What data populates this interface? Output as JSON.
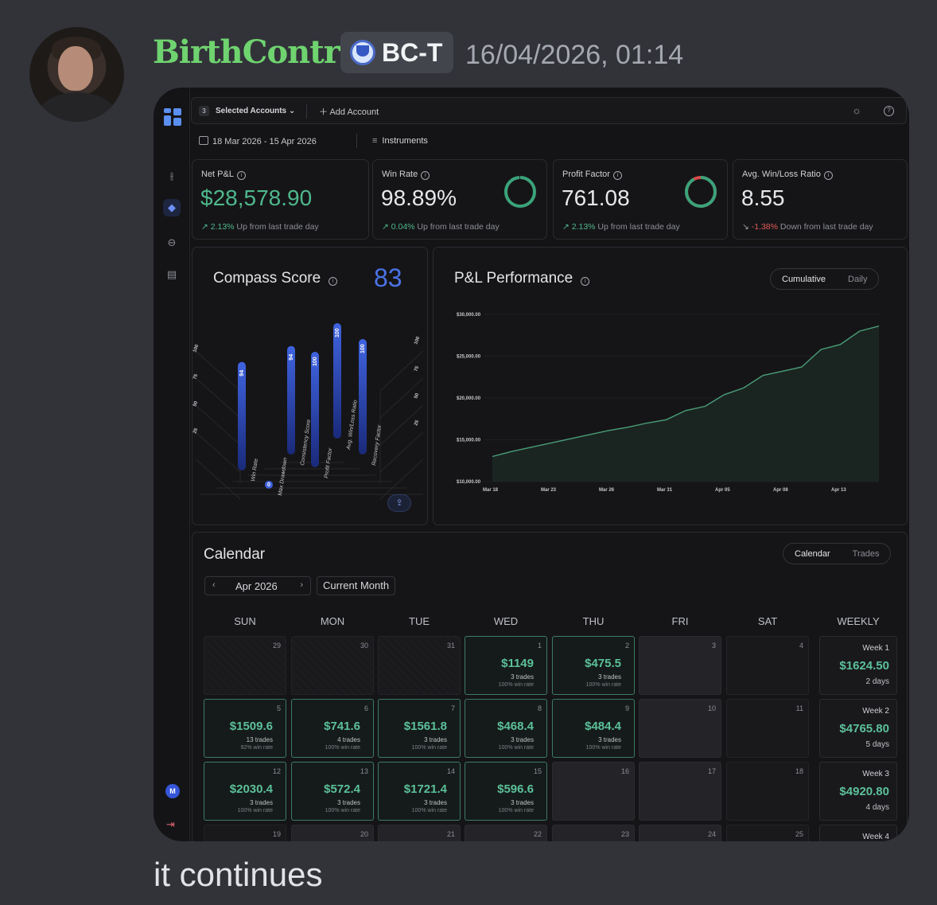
{
  "message": {
    "username": "BirthControl",
    "tag": "BC-T",
    "timestamp": "16/04/2026, 01:14",
    "caption": "it continues"
  },
  "app": {
    "topbar": {
      "account_count": "3",
      "selected_accounts": "Selected Accounts ⌄",
      "add_account": "Add Account"
    },
    "filters": {
      "date_range": "18 Mar 2026 - 15 Apr 2026",
      "instruments": "Instruments"
    },
    "stats": [
      {
        "title": "Net P&L",
        "value": "$28,578.90",
        "change": "2.13%",
        "direction": "up",
        "text": "Up from last trade day"
      },
      {
        "title": "Win Rate",
        "value": "98.89%",
        "change": "0.04%",
        "direction": "up",
        "text": "Up from last trade day",
        "ring_fraction": 0.9889
      },
      {
        "title": "Profit Factor",
        "value": "761.08",
        "change": "2.13%",
        "direction": "up",
        "text": "Up from last trade day",
        "ring_fraction": 0.92
      },
      {
        "title": "Avg. Win/Loss Ratio",
        "value": "8.55",
        "change": "-1.38%",
        "direction": "down",
        "text": "Down from last trade day"
      }
    ],
    "compass": {
      "title": "Compass Score",
      "score": "83",
      "metrics": [
        {
          "name": "Win Rate",
          "value": 94
        },
        {
          "name": "Max Drawdown",
          "value": 0
        },
        {
          "name": "Consistency Score",
          "value": 94
        },
        {
          "name": "Profit Factor",
          "value": 100
        },
        {
          "name": "Avg. Win/Loss Ratio",
          "value": 100
        },
        {
          "name": "Recovery Factor",
          "value": 100
        }
      ],
      "left_ticks": [
        "100",
        "75",
        "50",
        "25"
      ],
      "right_ticks": [
        "100",
        "75",
        "50",
        "25"
      ]
    },
    "pnl": {
      "title": "P&L Performance",
      "toggle_on": "Cumulative",
      "toggle_off": "Daily"
    },
    "calendar": {
      "title": "Calendar",
      "toggle_on": "Calendar",
      "toggle_off": "Trades",
      "month": "Apr 2026",
      "current_month": "Current Month",
      "headers": [
        "SUN",
        "MON",
        "TUE",
        "WED",
        "THU",
        "FRI",
        "SAT",
        "WEEKLY"
      ],
      "days": [
        {
          "num": "29",
          "type": "pre"
        },
        {
          "num": "30",
          "type": "pre"
        },
        {
          "num": "31",
          "type": "pre"
        },
        {
          "num": "1",
          "type": "win",
          "pnl": "$1149",
          "trades": "3 trades",
          "rate": "100% win rate"
        },
        {
          "num": "2",
          "type": "win",
          "pnl": "$475.5",
          "trades": "3 trades",
          "rate": "100% win rate"
        },
        {
          "num": "3",
          "type": "grey"
        },
        {
          "num": "4",
          "type": "empty"
        },
        {
          "num": "5",
          "type": "win",
          "pnl": "$1509.6",
          "trades": "13 trades",
          "rate": "92% win rate"
        },
        {
          "num": "6",
          "type": "win",
          "pnl": "$741.6",
          "trades": "4 trades",
          "rate": "100% win rate"
        },
        {
          "num": "7",
          "type": "win",
          "pnl": "$1561.8",
          "trades": "3 trades",
          "rate": "100% win rate"
        },
        {
          "num": "8",
          "type": "win",
          "pnl": "$468.4",
          "trades": "3 trades",
          "rate": "100% win rate"
        },
        {
          "num": "9",
          "type": "win",
          "pnl": "$484.4",
          "trades": "3 trades",
          "rate": "100% win rate"
        },
        {
          "num": "10",
          "type": "grey"
        },
        {
          "num": "11",
          "type": "empty"
        },
        {
          "num": "12",
          "type": "win",
          "pnl": "$2030.4",
          "trades": "3 trades",
          "rate": "100% win rate"
        },
        {
          "num": "13",
          "type": "win",
          "pnl": "$572.4",
          "trades": "3 trades",
          "rate": "100% win rate"
        },
        {
          "num": "14",
          "type": "win",
          "pnl": "$1721.4",
          "trades": "3 trades",
          "rate": "100% win rate"
        },
        {
          "num": "15",
          "type": "win",
          "pnl": "$596.6",
          "trades": "3 trades",
          "rate": "100% win rate"
        },
        {
          "num": "16",
          "type": "grey"
        },
        {
          "num": "17",
          "type": "grey"
        },
        {
          "num": "18",
          "type": "empty"
        },
        {
          "num": "19",
          "type": "empty"
        },
        {
          "num": "20",
          "type": "grey"
        },
        {
          "num": "21",
          "type": "grey"
        },
        {
          "num": "22",
          "type": "grey"
        },
        {
          "num": "23",
          "type": "grey"
        },
        {
          "num": "24",
          "type": "grey"
        },
        {
          "num": "25",
          "type": "empty"
        }
      ],
      "weeks": [
        {
          "label": "Week 1",
          "value": "$1624.50",
          "days": "2 days"
        },
        {
          "label": "Week 2",
          "value": "$4765.80",
          "days": "5 days"
        },
        {
          "label": "Week 3",
          "value": "$4920.80",
          "days": "4 days"
        },
        {
          "label": "Week 4",
          "value": "",
          "days": ""
        }
      ]
    }
  },
  "chart_data": {
    "type": "area",
    "title": "P&L Performance",
    "x": [
      "Mar 18",
      "Mar 19",
      "Mar 20",
      "Mar 23",
      "Mar 24",
      "Mar 25",
      "Mar 26",
      "Mar 27",
      "Mar 30",
      "Mar 31",
      "Apr 01",
      "Apr 02",
      "Apr 03",
      "Apr 05",
      "Apr 06",
      "Apr 07",
      "Apr 08",
      "Apr 09",
      "Apr 10",
      "Apr 12",
      "Apr 13",
      "Apr 14",
      "Apr 15"
    ],
    "values": [
      13000,
      13600,
      14100,
      14600,
      15100,
      15600,
      16100,
      16500,
      17000,
      17400,
      18500,
      19000,
      20400,
      21200,
      22700,
      23200,
      23700,
      25800,
      26400,
      28000,
      28600
    ],
    "x_ticks": [
      "Mar 18",
      "Mar 23",
      "Mar 26",
      "Mar 31",
      "Apr 05",
      "Apr 08",
      "Apr 13"
    ],
    "y_ticks": [
      "$10,000.00",
      "$15,000.00",
      "$20,000.00",
      "$25,000.00",
      "$30,000.00"
    ],
    "ylim": [
      10000,
      30000
    ],
    "grid": true,
    "colors": {
      "line": "#4a9d78",
      "fill": "#1a2521"
    }
  }
}
